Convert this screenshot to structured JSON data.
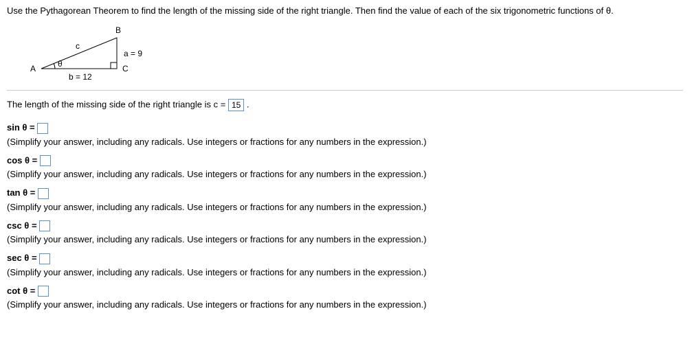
{
  "instruction": "Use the Pythagorean Theorem to find the length of the missing side of the right triangle.  Then find the value of each of the six trigonometric functions of θ.",
  "triangle": {
    "vertexA": "A",
    "vertexB": "B",
    "vertexC": "C",
    "sideA": "a = 9",
    "sideB": "b = 12",
    "sideC": "c",
    "angle": "θ"
  },
  "missingSide": {
    "textBefore": "The length of the missing side of the right triangle is c =",
    "value": "15",
    "textAfter": "."
  },
  "hint": "(Simplify your answer, including any radicals.  Use integers or fractions for any numbers in the expression.)",
  "funcs": {
    "sin": "sin θ =",
    "cos": "cos θ =",
    "tan": "tan θ =",
    "csc": "csc θ =",
    "sec": "sec θ =",
    "cot": "cot θ ="
  }
}
